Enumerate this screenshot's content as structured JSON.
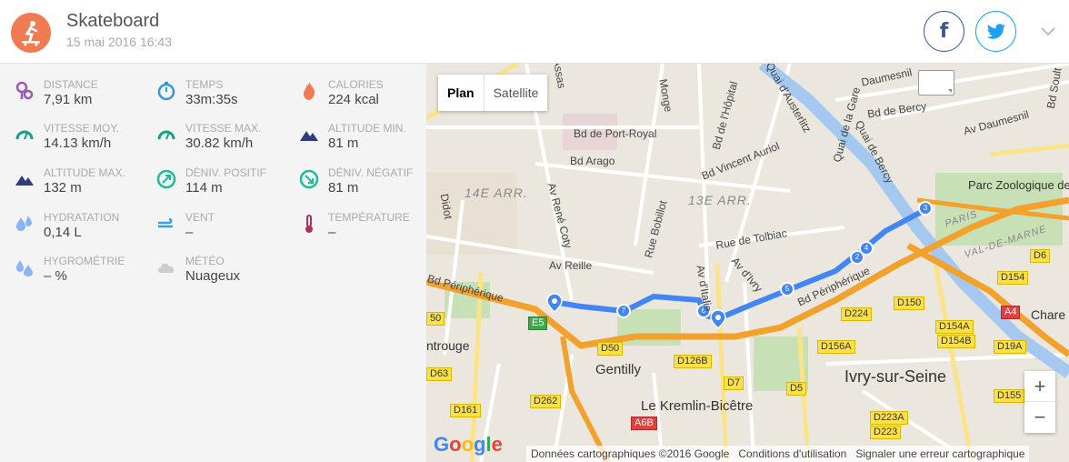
{
  "activity": {
    "title": "Skateboard",
    "date": "15 mai 2016 16:43",
    "icon": "skateboard-icon"
  },
  "social": {
    "facebook_icon": "f",
    "twitter_icon": "twitter-bird"
  },
  "stats": [
    {
      "label": "Distance",
      "value": "7,91 km",
      "icon": "distance-icon",
      "color": "#9b59b6"
    },
    {
      "label": "Temps",
      "value": "33m:35s",
      "icon": "stopwatch-icon",
      "color": "#3498db"
    },
    {
      "label": "Calories",
      "value": "224 kcal",
      "icon": "flame-icon",
      "color": "#f07b52"
    },
    {
      "label": "Vitesse moy.",
      "value": "14.13 km/h",
      "icon": "speedometer-icon",
      "color": "#16a085"
    },
    {
      "label": "Vitesse max.",
      "value": "30.82 km/h",
      "icon": "speedometer-icon",
      "color": "#16a085"
    },
    {
      "label": "Altitude min.",
      "value": "81 m",
      "icon": "mountain-icon",
      "color": "#2c3e80"
    },
    {
      "label": "Altitude max.",
      "value": "132 m",
      "icon": "mountain-icon",
      "color": "#2c3e80"
    },
    {
      "label": "Déniv. positif",
      "value": "114 m",
      "icon": "ascent-icon",
      "color": "#1abc9c"
    },
    {
      "label": "Déniv. négatif",
      "value": "81 m",
      "icon": "descent-icon",
      "color": "#1abc9c"
    },
    {
      "label": "Hydratation",
      "value": "0,14 L",
      "icon": "water-drops-icon",
      "color": "#8ab4f8"
    },
    {
      "label": "Vent",
      "value": "–",
      "icon": "wind-icon",
      "color": "#3aa0d8"
    },
    {
      "label": "Température",
      "value": "–",
      "icon": "thermometer-icon",
      "color": "#b03060"
    },
    {
      "label": "Hygrométrie",
      "value": "– %",
      "icon": "humidity-icon",
      "color": "#8ab4f8"
    },
    {
      "label": "Météo",
      "value": "Nuageux",
      "icon": "cloud-icon",
      "color": "#cccccc"
    }
  ],
  "map": {
    "map_type": {
      "plan": "Plan",
      "satellite": "Satellite"
    },
    "zoom_in": "+",
    "zoom_out": "−",
    "logo": "Google",
    "attribution": {
      "data": "Données cartographiques ©2016 Google",
      "terms": "Conditions d'utilisation",
      "report": "Signaler une erreur cartographique"
    },
    "streets": [
      "Assas",
      "Bd de Port-Royal",
      "Monge",
      "Bd de l'Hôpital",
      "Quai d'Austerlitz",
      "Quai de la Gare",
      "Daumesnil",
      "Bd de Bercy",
      "Av Daumesnil",
      "Bd Arago",
      "Bd Vincent Auriol",
      "Quai de Bercy",
      "Av René Coty",
      "Didot",
      "Rue Bobillot",
      "Rue de Tolbiac",
      "Av d'Italie",
      "Av d'Ivry",
      "Av Reille",
      "Bd Périphérique",
      "Bd Périphérique",
      "Bd Soult"
    ],
    "districts": [
      "14E ARR.",
      "13E ARR.",
      "PARIS",
      "VAL-DE-MARNE"
    ],
    "cities": [
      "Gentilly",
      "Le Kremlin-Bicêtre",
      "Ivry-sur-Seine",
      "ntrouge",
      "Chare",
      "Parc Zoologique de"
    ],
    "road_badges": [
      "E5",
      "D50",
      "D126B",
      "D7",
      "D5",
      "D262",
      "D161",
      "A6B",
      "D63",
      "D224",
      "D150",
      "D156A",
      "D154A",
      "D154B",
      "D19A",
      "D154",
      "D6",
      "A4",
      "D223A",
      "D155",
      "D223",
      "50"
    ],
    "route_markers": [
      "1",
      "2",
      "3",
      "4",
      "5",
      "6",
      "7"
    ]
  }
}
